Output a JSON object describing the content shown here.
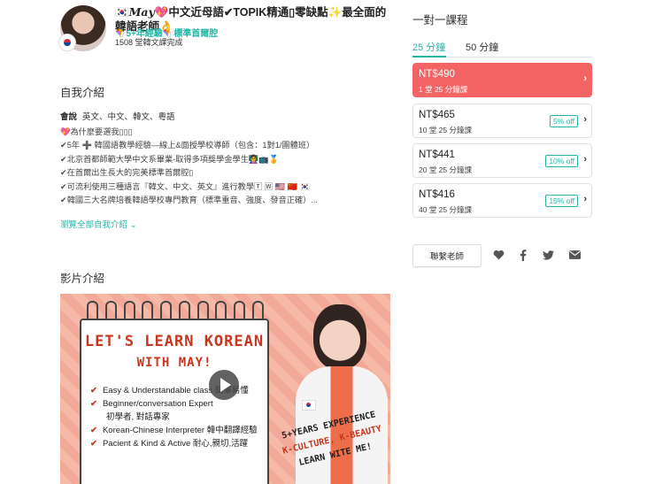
{
  "teacher": {
    "name_part": "May",
    "title": "中文近母語✔TOPIK精通▯零缺點✨最全面的韓語老師👌",
    "badges": "🪁5+年經驗🪁標準首爾腔",
    "lesson_count": "1508 堂韓文課完成"
  },
  "intro": {
    "heading": "自我介紹",
    "speaks_label": "會說",
    "languages": "英文、中文、韓文、粵語",
    "lines": [
      "💖為什麼要選我▯▯▯",
      "✔5年 ➕ 韓國語教學經驗—線上&面授學校導師（包含：1對1/團體班）",
      "✔北京首都師範大學中文系畢業-取得多項獎學金學生👩‍🏫📺🏅",
      "✔在首爾出生長大的完美標準首爾腔▯",
      "✔可流利使用三種語言『韓文、中文、英文』進行教學🅃 🅆 🇺🇸 🇨🇳 🇰🇷",
      "✔韓國三大名牌培養韓語學校專門教育（標準重音、強度、發音正確）..."
    ],
    "read_more": "瀏覽全部自我介紹 ⌄"
  },
  "video": {
    "heading": "影片介紹",
    "board_title_1": "LET'S LEARN KOREAN",
    "board_title_2": "WITH MAY!",
    "bullets": [
      "Easy & Understandable class 簡單易懂",
      "Beginner/conversation Expert",
      "初學者, 對話專家",
      "Korean-Chinese Interpreter 韓中翻譯經驗",
      "Pacient & Kind & Active 耐心,親切,活躍"
    ],
    "tag_1": "5+YEARS EXPERIENCE",
    "tag_2": "K-CULTURE, K-BEAUTY",
    "tag_3": "LEARN WITE ME!"
  },
  "trial": {
    "heading": "一對一課程",
    "tabs": [
      "25 分鐘",
      "50 分鐘"
    ],
    "packages": [
      {
        "price": "NT$490",
        "sub": "1 堂 25 分鐘課",
        "off": ""
      },
      {
        "price": "NT$465",
        "sub": "10 堂 25 分鐘課",
        "off": "5% off"
      },
      {
        "price": "NT$441",
        "sub": "20 堂 25 分鐘課",
        "off": "10% off"
      },
      {
        "price": "NT$416",
        "sub": "40 堂 25 分鐘課",
        "off": "15% off"
      }
    ],
    "contact": "聯繫老師"
  },
  "colors": {
    "accent": "#25b6a6",
    "selected": "#f46464"
  },
  "icons": [
    "heart-icon",
    "facebook-icon",
    "twitter-icon",
    "email-icon",
    "chevron-right-icon",
    "play-icon"
  ]
}
